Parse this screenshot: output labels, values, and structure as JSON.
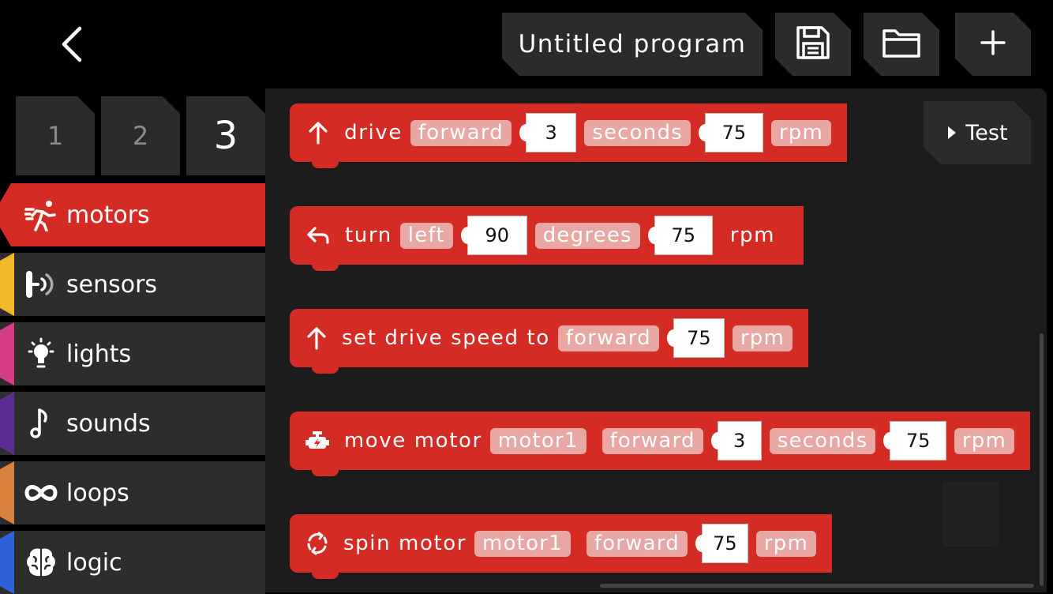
{
  "header": {
    "program_title": "Untitled program",
    "icons": {
      "back": "chevron-left-icon",
      "save": "save-icon",
      "open": "folder-icon",
      "new": "plus-icon"
    }
  },
  "pages": [
    {
      "label": "1",
      "active": false
    },
    {
      "label": "2",
      "active": false
    },
    {
      "label": "3",
      "active": true
    }
  ],
  "categories": [
    {
      "label": "motors",
      "icon": "running-icon",
      "color": "#d42b25",
      "active": true
    },
    {
      "label": "sensors",
      "icon": "sensor-icon",
      "color": "#f2b72a",
      "active": false
    },
    {
      "label": "lights",
      "icon": "lightbulb-icon",
      "color": "#d63a82",
      "active": false
    },
    {
      "label": "sounds",
      "icon": "music-note-icon",
      "color": "#5b2d91",
      "active": false
    },
    {
      "label": "loops",
      "icon": "loop-icon",
      "color": "#d9823e",
      "active": false
    },
    {
      "label": "logic",
      "icon": "brain-icon",
      "color": "#2f62d8",
      "active": false
    }
  ],
  "blocks": {
    "drive": {
      "icon": "arrow-up-icon",
      "label": "drive",
      "direction": "forward",
      "duration": "3",
      "duration_unit": "seconds",
      "speed": "75",
      "speed_unit": "rpm"
    },
    "turn": {
      "icon": "turn-left-icon",
      "label": "turn",
      "direction": "left",
      "angle": "90",
      "angle_unit": "degrees",
      "speed": "75",
      "speed_unit": "rpm"
    },
    "set_speed": {
      "icon": "arrow-up-icon",
      "label": "set drive speed to",
      "direction": "forward",
      "speed": "75",
      "speed_unit": "rpm"
    },
    "move_motor": {
      "icon": "motor-icon",
      "label": "move motor",
      "motor": "motor1",
      "direction": "forward",
      "duration": "3",
      "duration_unit": "seconds",
      "speed": "75",
      "speed_unit": "rpm"
    },
    "spin_motor": {
      "icon": "spin-icon",
      "label": "spin motor",
      "motor": "motor1",
      "direction": "forward",
      "speed": "75",
      "speed_unit": "rpm"
    }
  },
  "test_button": {
    "label": "Test",
    "icon": "play-icon"
  }
}
